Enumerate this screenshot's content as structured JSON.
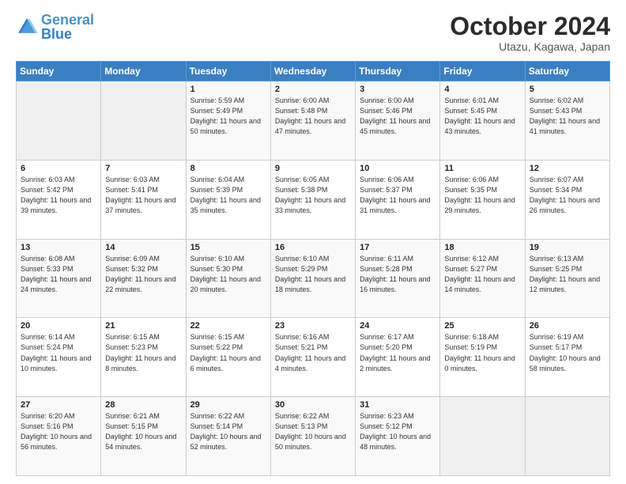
{
  "header": {
    "logo_general": "General",
    "logo_blue": "Blue",
    "month_title": "October 2024",
    "location": "Utazu, Kagawa, Japan"
  },
  "days_of_week": [
    "Sunday",
    "Monday",
    "Tuesday",
    "Wednesday",
    "Thursday",
    "Friday",
    "Saturday"
  ],
  "weeks": [
    [
      {
        "day": "",
        "info": ""
      },
      {
        "day": "",
        "info": ""
      },
      {
        "day": "1",
        "info": "Sunrise: 5:59 AM\nSunset: 5:49 PM\nDaylight: 11 hours and 50 minutes."
      },
      {
        "day": "2",
        "info": "Sunrise: 6:00 AM\nSunset: 5:48 PM\nDaylight: 11 hours and 47 minutes."
      },
      {
        "day": "3",
        "info": "Sunrise: 6:00 AM\nSunset: 5:46 PM\nDaylight: 11 hours and 45 minutes."
      },
      {
        "day": "4",
        "info": "Sunrise: 6:01 AM\nSunset: 5:45 PM\nDaylight: 11 hours and 43 minutes."
      },
      {
        "day": "5",
        "info": "Sunrise: 6:02 AM\nSunset: 5:43 PM\nDaylight: 11 hours and 41 minutes."
      }
    ],
    [
      {
        "day": "6",
        "info": "Sunrise: 6:03 AM\nSunset: 5:42 PM\nDaylight: 11 hours and 39 minutes."
      },
      {
        "day": "7",
        "info": "Sunrise: 6:03 AM\nSunset: 5:41 PM\nDaylight: 11 hours and 37 minutes."
      },
      {
        "day": "8",
        "info": "Sunrise: 6:04 AM\nSunset: 5:39 PM\nDaylight: 11 hours and 35 minutes."
      },
      {
        "day": "9",
        "info": "Sunrise: 6:05 AM\nSunset: 5:38 PM\nDaylight: 11 hours and 33 minutes."
      },
      {
        "day": "10",
        "info": "Sunrise: 6:06 AM\nSunset: 5:37 PM\nDaylight: 11 hours and 31 minutes."
      },
      {
        "day": "11",
        "info": "Sunrise: 6:06 AM\nSunset: 5:35 PM\nDaylight: 11 hours and 29 minutes."
      },
      {
        "day": "12",
        "info": "Sunrise: 6:07 AM\nSunset: 5:34 PM\nDaylight: 11 hours and 26 minutes."
      }
    ],
    [
      {
        "day": "13",
        "info": "Sunrise: 6:08 AM\nSunset: 5:33 PM\nDaylight: 11 hours and 24 minutes."
      },
      {
        "day": "14",
        "info": "Sunrise: 6:09 AM\nSunset: 5:32 PM\nDaylight: 11 hours and 22 minutes."
      },
      {
        "day": "15",
        "info": "Sunrise: 6:10 AM\nSunset: 5:30 PM\nDaylight: 11 hours and 20 minutes."
      },
      {
        "day": "16",
        "info": "Sunrise: 6:10 AM\nSunset: 5:29 PM\nDaylight: 11 hours and 18 minutes."
      },
      {
        "day": "17",
        "info": "Sunrise: 6:11 AM\nSunset: 5:28 PM\nDaylight: 11 hours and 16 minutes."
      },
      {
        "day": "18",
        "info": "Sunrise: 6:12 AM\nSunset: 5:27 PM\nDaylight: 11 hours and 14 minutes."
      },
      {
        "day": "19",
        "info": "Sunrise: 6:13 AM\nSunset: 5:25 PM\nDaylight: 11 hours and 12 minutes."
      }
    ],
    [
      {
        "day": "20",
        "info": "Sunrise: 6:14 AM\nSunset: 5:24 PM\nDaylight: 11 hours and 10 minutes."
      },
      {
        "day": "21",
        "info": "Sunrise: 6:15 AM\nSunset: 5:23 PM\nDaylight: 11 hours and 8 minutes."
      },
      {
        "day": "22",
        "info": "Sunrise: 6:15 AM\nSunset: 5:22 PM\nDaylight: 11 hours and 6 minutes."
      },
      {
        "day": "23",
        "info": "Sunrise: 6:16 AM\nSunset: 5:21 PM\nDaylight: 11 hours and 4 minutes."
      },
      {
        "day": "24",
        "info": "Sunrise: 6:17 AM\nSunset: 5:20 PM\nDaylight: 11 hours and 2 minutes."
      },
      {
        "day": "25",
        "info": "Sunrise: 6:18 AM\nSunset: 5:19 PM\nDaylight: 11 hours and 0 minutes."
      },
      {
        "day": "26",
        "info": "Sunrise: 6:19 AM\nSunset: 5:17 PM\nDaylight: 10 hours and 58 minutes."
      }
    ],
    [
      {
        "day": "27",
        "info": "Sunrise: 6:20 AM\nSunset: 5:16 PM\nDaylight: 10 hours and 56 minutes."
      },
      {
        "day": "28",
        "info": "Sunrise: 6:21 AM\nSunset: 5:15 PM\nDaylight: 10 hours and 54 minutes."
      },
      {
        "day": "29",
        "info": "Sunrise: 6:22 AM\nSunset: 5:14 PM\nDaylight: 10 hours and 52 minutes."
      },
      {
        "day": "30",
        "info": "Sunrise: 6:22 AM\nSunset: 5:13 PM\nDaylight: 10 hours and 50 minutes."
      },
      {
        "day": "31",
        "info": "Sunrise: 6:23 AM\nSunset: 5:12 PM\nDaylight: 10 hours and 48 minutes."
      },
      {
        "day": "",
        "info": ""
      },
      {
        "day": "",
        "info": ""
      }
    ]
  ]
}
